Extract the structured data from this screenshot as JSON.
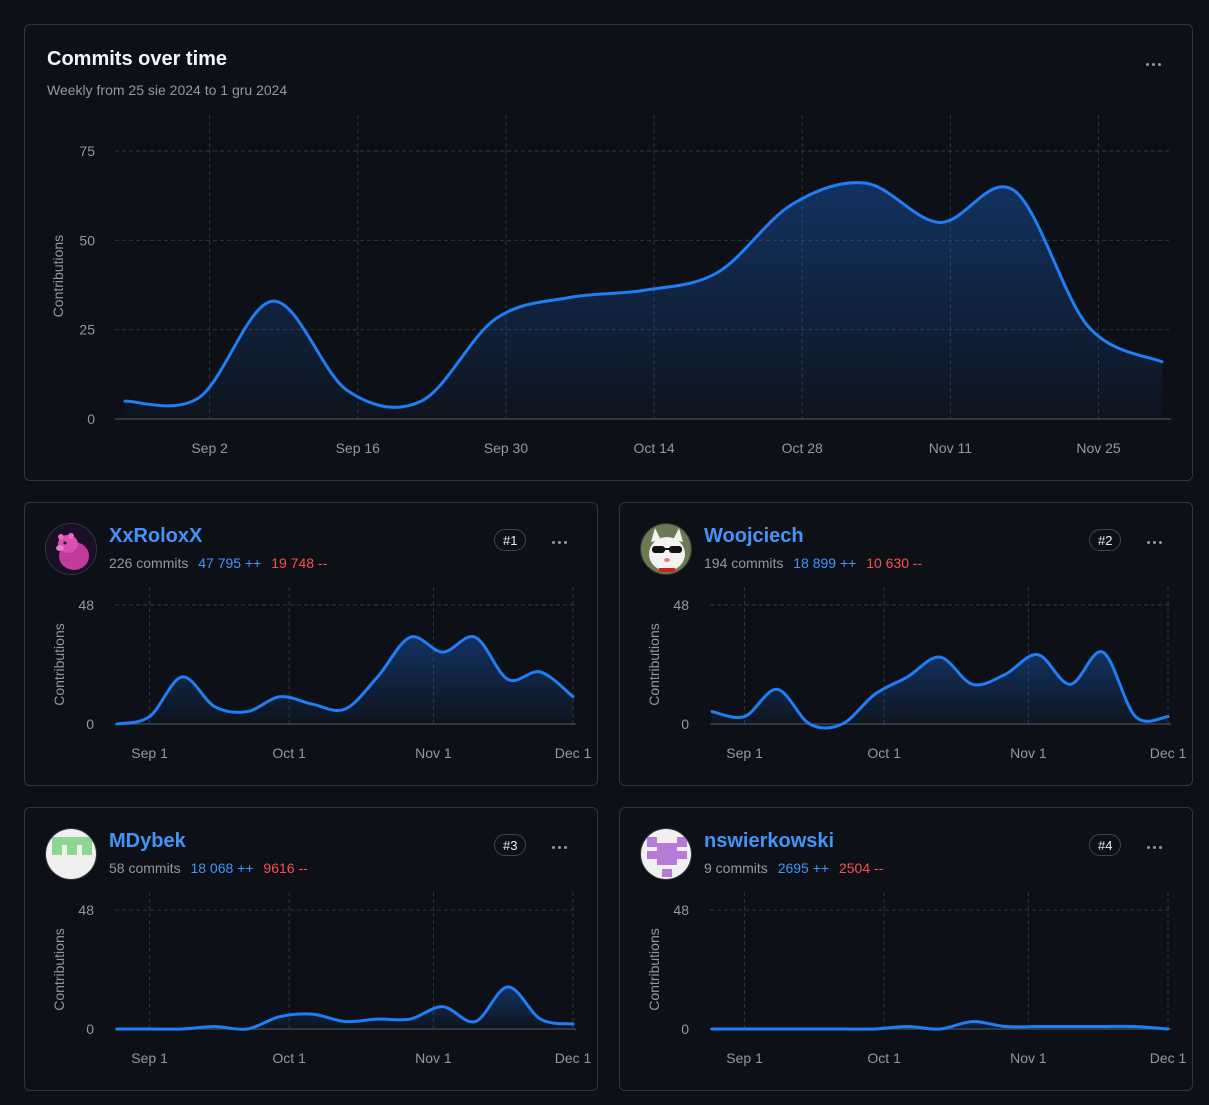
{
  "main": {
    "title": "Commits over time",
    "subtitle": "Weekly from 25 sie 2024 to 1 gru 2024",
    "chart_data": {
      "type": "area",
      "ylabel": "Contributions",
      "ylim": [
        0,
        80
      ],
      "yticks": [
        0,
        25,
        50,
        75
      ],
      "xtick_labels": [
        "Sep 2",
        "Sep 16",
        "Sep 30",
        "Oct 14",
        "Oct 28",
        "Nov 11",
        "Nov 25"
      ],
      "x": [
        "Aug 25",
        "Sep 1",
        "Sep 8",
        "Sep 15",
        "Sep 22",
        "Sep 29",
        "Oct 6",
        "Oct 13",
        "Oct 20",
        "Oct 27",
        "Nov 3",
        "Nov 10",
        "Nov 17",
        "Nov 24",
        "Dec 1"
      ],
      "values": [
        5,
        6,
        33,
        8,
        5,
        28,
        34,
        36,
        41,
        60,
        66,
        55,
        64,
        26,
        16
      ],
      "grid": true,
      "colors": {
        "line": "#1f7ef5",
        "fill": "#1f6feb"
      }
    }
  },
  "contributors": [
    {
      "name": "XxRoloxX",
      "rank": "#1",
      "commits": "226 commits",
      "additions": "47 795 ++",
      "deletions": "19 748 --",
      "avatar": "pink-capybara",
      "chart_data": {
        "type": "area",
        "ylabel": "Contributions",
        "ylim": [
          0,
          48
        ],
        "yticks": [
          0,
          48
        ],
        "xtick_labels": [
          "Sep 1",
          "Oct 1",
          "Nov 1",
          "Dec 1"
        ],
        "x": [
          "Aug 25",
          "Sep 1",
          "Sep 8",
          "Sep 15",
          "Sep 22",
          "Sep 29",
          "Oct 6",
          "Oct 13",
          "Oct 20",
          "Oct 27",
          "Nov 3",
          "Nov 10",
          "Nov 17",
          "Nov 24",
          "Dec 1"
        ],
        "values": [
          0,
          3,
          19,
          7,
          5,
          11,
          8,
          6,
          19,
          35,
          29,
          35,
          18,
          21,
          11
        ]
      }
    },
    {
      "name": "Woojciech",
      "rank": "#2",
      "commits": "194 commits",
      "additions": "18 899 ++",
      "deletions": "10 630 --",
      "avatar": "cat-with-sunglasses",
      "chart_data": {
        "type": "area",
        "ylabel": "Contributions",
        "ylim": [
          0,
          48
        ],
        "yticks": [
          0,
          48
        ],
        "xtick_labels": [
          "Sep 1",
          "Oct 1",
          "Nov 1",
          "Dec 1"
        ],
        "x": [
          "Aug 25",
          "Sep 1",
          "Sep 8",
          "Sep 15",
          "Sep 22",
          "Sep 29",
          "Oct 6",
          "Oct 13",
          "Oct 20",
          "Oct 27",
          "Nov 3",
          "Nov 10",
          "Nov 17",
          "Nov 24",
          "Dec 1"
        ],
        "values": [
          5,
          3,
          14,
          0,
          0,
          12,
          19,
          27,
          16,
          20,
          28,
          16,
          29,
          3,
          3
        ]
      }
    },
    {
      "name": "MDybek",
      "rank": "#3",
      "commits": "58 commits",
      "additions": "18 068 ++",
      "deletions": "9616 --",
      "avatar": "green-identicon",
      "chart_data": {
        "type": "area",
        "ylabel": "Contributions",
        "ylim": [
          0,
          48
        ],
        "yticks": [
          0,
          48
        ],
        "xtick_labels": [
          "Sep 1",
          "Oct 1",
          "Nov 1",
          "Dec 1"
        ],
        "x": [
          "Aug 25",
          "Sep 1",
          "Sep 8",
          "Sep 15",
          "Sep 22",
          "Sep 29",
          "Oct 6",
          "Oct 13",
          "Oct 20",
          "Oct 27",
          "Nov 3",
          "Nov 10",
          "Nov 17",
          "Nov 24",
          "Dec 1"
        ],
        "values": [
          0,
          0,
          0,
          1,
          0,
          5,
          6,
          3,
          4,
          4,
          9,
          3,
          17,
          4,
          2
        ]
      }
    },
    {
      "name": "nswierkowski",
      "rank": "#4",
      "commits": "9 commits",
      "additions": "2695 ++",
      "deletions": "2504 --",
      "avatar": "purple-identicon",
      "chart_data": {
        "type": "area",
        "ylabel": "Contributions",
        "ylim": [
          0,
          48
        ],
        "yticks": [
          0,
          48
        ],
        "xtick_labels": [
          "Sep 1",
          "Oct 1",
          "Nov 1",
          "Dec 1"
        ],
        "x": [
          "Aug 25",
          "Sep 1",
          "Sep 8",
          "Sep 15",
          "Sep 22",
          "Sep 29",
          "Oct 6",
          "Oct 13",
          "Oct 20",
          "Oct 27",
          "Nov 3",
          "Nov 10",
          "Nov 17",
          "Nov 24",
          "Dec 1"
        ],
        "values": [
          0,
          0,
          0,
          0,
          0,
          0,
          1,
          0,
          3,
          1,
          1,
          1,
          1,
          1,
          0
        ]
      }
    }
  ]
}
